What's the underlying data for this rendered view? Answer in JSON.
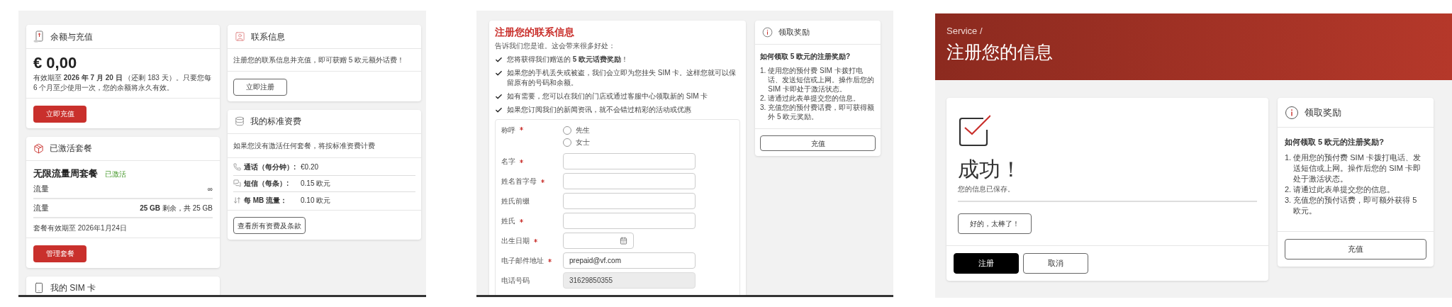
{
  "balance_screen": {
    "balance_card": {
      "title": "余额与充值",
      "amount": "€ 0,00",
      "validity": "有效期至 **2026 年 7 月 20 日** （还剩 183 天）。只要您每 6 个月至少使用一次，您的余额将永久有效。",
      "button": "立即充值"
    },
    "bundle_card": {
      "title": "已激活套餐",
      "bundle_name": "无限流量周套餐",
      "status": "已激活",
      "rows": [
        {
          "label": "流量",
          "value": "∞"
        },
        {
          "label": "流量",
          "value": "**25 GB** 剩余，共 25 GB"
        }
      ],
      "expiry": "套餐有效期至 2026年1月24日",
      "button": "管理套餐"
    },
    "sim_card": {
      "title": "我的 SIM 卡"
    },
    "contact_card": {
      "title": "联系信息",
      "text": "注册您的联系信息并充值，即可获赠 5 欧元额外话费！",
      "button": "立即注册"
    },
    "rates_card": {
      "title": "我的标准资费",
      "text": "如果您没有激活任何套餐，将按标准资费计费",
      "rates": [
        {
          "kind": "call",
          "label": "通话（每分钟）:",
          "value": "€0.20"
        },
        {
          "kind": "sms",
          "label": "短信（每条）:",
          "value": "0.15 欧元"
        },
        {
          "kind": "data",
          "label": "每 MB 流量：",
          "value": "0.10 欧元"
        }
      ],
      "button": "查看所有资费及条款"
    }
  },
  "registration_screen": {
    "title": "注册您的联系信息",
    "intro": "告诉我们您是谁。这会带来很多好处：",
    "benefits": [
      "您将获得我们赠送的 **5 欧元话费奖励**！",
      "如果您的手机丢失或被盗，我们会立即为您挂失 SIM 卡。这样您就可以保留原有的号码和余额。",
      "如有需要，您可以在我们的门店或通过客服中心领取新的 SIM 卡",
      "如果您订阅我们的新闻资讯，就不会错过精彩的活动或优惠"
    ],
    "form": {
      "salutation": {
        "label": "称呼",
        "required": true,
        "options": [
          {
            "label": "先生",
            "selected": false
          },
          {
            "label": "女士",
            "selected": false
          }
        ]
      },
      "fields": [
        {
          "kind": "text",
          "label": "名字",
          "required": true
        },
        {
          "kind": "text",
          "label": "姓名首字母",
          "required": true
        },
        {
          "kind": "text",
          "label": "姓氏前缀",
          "required": false
        },
        {
          "kind": "text",
          "label": "姓氏",
          "required": true
        },
        {
          "kind": "date",
          "label": "出生日期",
          "required": true
        },
        {
          "kind": "text",
          "label": "电子邮件地址",
          "required": true,
          "value": "prepaid@vf.com"
        },
        {
          "kind": "text",
          "label": "电话号码",
          "required": false,
          "disabled": true,
          "value": "31629850355"
        }
      ]
    },
    "reward_card": {
      "title": "领取奖励",
      "question": "如何领取 5 欧元的注册奖励?",
      "steps": [
        {
          "number": "1.",
          "text": "使用您的预付费 SIM 卡拨打电话、发送短信或上网。操作后您的 SIM 卡即处于激活状态。"
        },
        {
          "number": "2.",
          "text": "请通过此表单提交您的信息。"
        },
        {
          "number": "3.",
          "text": "充值您的预付费话费，即可获得额外 5 欧元奖励。"
        }
      ],
      "button": "充值"
    }
  },
  "success_screen": {
    "breadcrumb": "Service /",
    "title": "注册您的信息",
    "success": {
      "heading": "成功！",
      "message": "您的信息已保存。",
      "button": "好的，太棒了！"
    },
    "actions": [
      {
        "kind": "primary",
        "label": "注册"
      },
      {
        "kind": "secondary",
        "label": "取消"
      }
    ],
    "reward_card": {
      "title": "领取奖励",
      "question": "如何领取 5 欧元的注册奖励?",
      "steps": [
        {
          "number": "1.",
          "text": "使用您的预付费 SIM 卡拨打电话、发送短信或上网。操作后您的 SIM 卡即处于激活状态。"
        },
        {
          "number": "2.",
          "text": "请通过此表单提交您的信息。"
        },
        {
          "number": "3.",
          "text": "充值您的预付话费，即可额外获得 5 欧元。"
        }
      ],
      "button": "充值"
    }
  }
}
